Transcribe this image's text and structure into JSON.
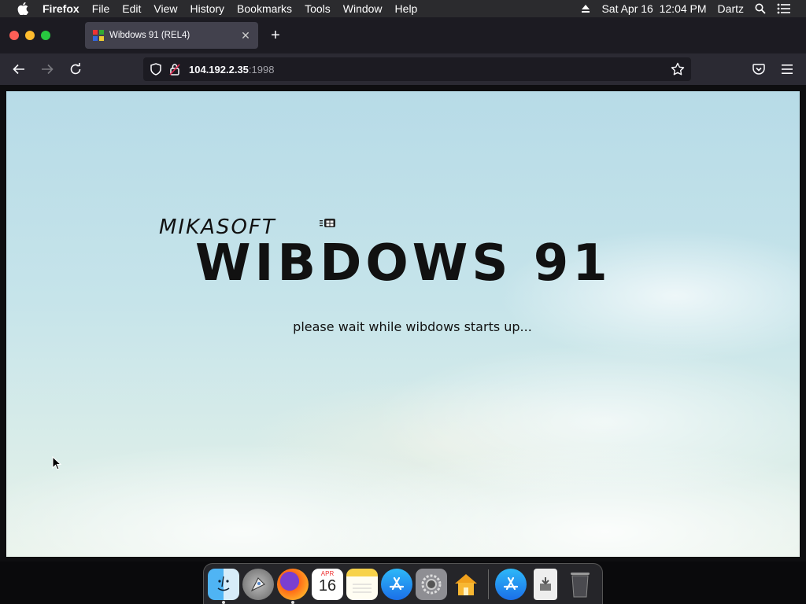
{
  "menubar": {
    "app_name": "Firefox",
    "items": [
      "File",
      "Edit",
      "View",
      "History",
      "Bookmarks",
      "Tools",
      "Window",
      "Help"
    ],
    "clock": "Sat Apr 16  12:04 PM",
    "user": "Dartz"
  },
  "browser": {
    "tab_title": "Wibdows 91 (REL4)",
    "url_host": "104.192.2.35",
    "url_port": ":1998"
  },
  "page": {
    "vendor": "MIKASOFT",
    "product": "WIBDOWS 91",
    "status": "please wait while wibdows starts up..."
  },
  "dock": {
    "calendar_month": "APR",
    "calendar_day": "16"
  },
  "colors": {
    "sky_top": "#b7dbe7",
    "sky_bottom": "#e8f2ea",
    "firefox_toolbar": "#2b2a33",
    "tab_bg": "#42414d"
  }
}
